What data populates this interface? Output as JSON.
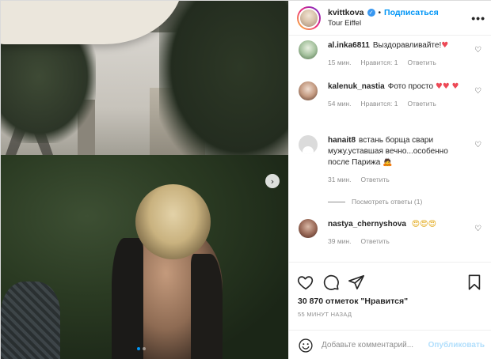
{
  "post": {
    "username": "kvittkova",
    "separator": "•",
    "follow_label": "Подписаться",
    "location": "Tour Eiffel",
    "more_label": "•••",
    "verified_glyph": "✓"
  },
  "photo": {
    "next_glyph": "›",
    "carousel_count": 2,
    "carousel_active": 1
  },
  "comments": [
    {
      "user": "al.inka6811",
      "text": "Выздоравливайте!",
      "emoji": "♥",
      "time": "15 мин.",
      "likes": "Нравится: 1",
      "reply": "Ответить"
    },
    {
      "user": "kalenuk_nastia",
      "text": "Фото просто",
      "emoji": "♥♥",
      "emoji2": "♥",
      "time": "54 мин.",
      "likes": "Нравится: 1",
      "reply": "Ответить"
    },
    {
      "user": "hanait8",
      "text": "встань борща свари мужу.уставшая вечно...особенно после Парижа",
      "emoji": "🙇",
      "time": "31 мин.",
      "reply": "Ответить"
    },
    {
      "user": "nastya_chernyshova",
      "text": "",
      "emoji": "😍😍😍",
      "time": "39 мин.",
      "reply": "Ответить"
    }
  ],
  "view_replies": "Посмотреть ответы (1)",
  "like_glyph": "♡",
  "stats": {
    "likes": "30 870 отметок \"Нравится\"",
    "time": "55 МИНУТ НАЗАД"
  },
  "add_comment": {
    "placeholder": "Добавьте комментарий...",
    "publish_label": "Опубликовать"
  },
  "colors": {
    "accent": "#0095f6",
    "heart": "#ed4956",
    "meta": "#8e8e8e",
    "publish_disabled": "#b2dffc"
  }
}
